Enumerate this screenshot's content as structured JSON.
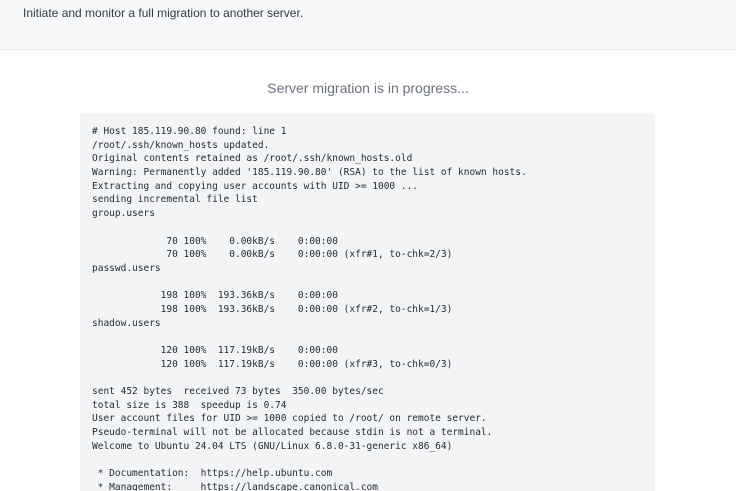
{
  "header": {
    "description": "Initiate and monitor a full migration to another server."
  },
  "status": {
    "message": "Server migration is in progress..."
  },
  "terminal": {
    "lines": [
      "# Host 185.119.90.80 found: line 1",
      "/root/.ssh/known_hosts updated.",
      "Original contents retained as /root/.ssh/known_hosts.old",
      "Warning: Permanently added '185.119.90.80' (RSA) to the list of known hosts.",
      "Extracting and copying user accounts with UID >= 1000 ...",
      "sending incremental file list",
      "group.users",
      "",
      "             70 100%    0.00kB/s    0:00:00",
      "             70 100%    0.00kB/s    0:00:00 (xfr#1, to-chk=2/3)",
      "passwd.users",
      "",
      "            198 100%  193.36kB/s    0:00:00",
      "            198 100%  193.36kB/s    0:00:00 (xfr#2, to-chk=1/3)",
      "shadow.users",
      "",
      "            120 100%  117.19kB/s    0:00:00",
      "            120 100%  117.19kB/s    0:00:00 (xfr#3, to-chk=0/3)",
      "",
      "sent 452 bytes  received 73 bytes  350.00 bytes/sec",
      "total size is 388  speedup is 0.74",
      "User account files for UID >= 1000 copied to /root/ on remote server.",
      "Pseudo-terminal will not be allocated because stdin is not a terminal.",
      "Welcome to Ubuntu 24.04 LTS (GNU/Linux 6.8.0-31-generic x86_64)",
      "",
      " * Documentation:  https://help.ubuntu.com",
      " * Management:     https://landscape.canonical.com"
    ]
  }
}
